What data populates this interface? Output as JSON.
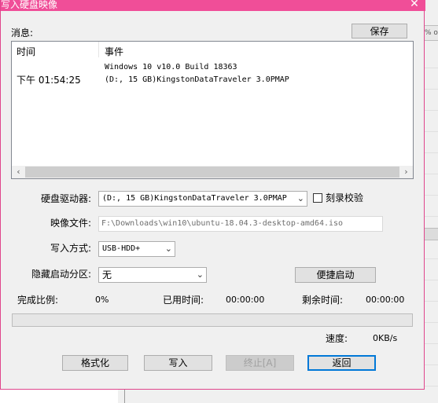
{
  "window": {
    "title": "写入硬盘映像",
    "close_glyph": "✕"
  },
  "background": {
    "strip_text": "% o"
  },
  "messages": {
    "label": "消息:",
    "save_label": "保存",
    "columns": {
      "time": "时间",
      "event": "事件"
    },
    "rows": [
      {
        "time": "",
        "event": "Windows 10 v10.0 Build 18363"
      },
      {
        "time": "下午 01:54:25",
        "event": "(D:, 15 GB)KingstonDataTraveler 3.0PMAP"
      }
    ]
  },
  "form": {
    "drive_label": "硬盘驱动器:",
    "drive_value": "(D:, 15 GB)KingstonDataTraveler 3.0PMAP",
    "verify_label": "刻录校验",
    "verify_checked": false,
    "image_label": "映像文件:",
    "image_value": "F:\\Downloads\\win10\\ubuntu-18.04.3-desktop-amd64.iso",
    "method_label": "写入方式:",
    "method_value": "USB-HDD+",
    "hide_label": "隐藏启动分区:",
    "hide_value": "无",
    "quick_boot_label": "便捷启动"
  },
  "status": {
    "complete_label": "完成比例:",
    "complete_value": "0%",
    "progress_fraction": 0,
    "elapsed_label": "已用时间:",
    "elapsed_value": "00:00:00",
    "remaining_label": "剩余时间:",
    "remaining_value": "00:00:00",
    "speed_label": "速度:",
    "speed_value": "0KB/s"
  },
  "buttons": {
    "format": "格式化",
    "write": "写入",
    "stop": "终止[A]",
    "back": "返回"
  },
  "icons": {
    "scroll_left": "‹",
    "scroll_right": "›",
    "dropdown": "⌄"
  }
}
